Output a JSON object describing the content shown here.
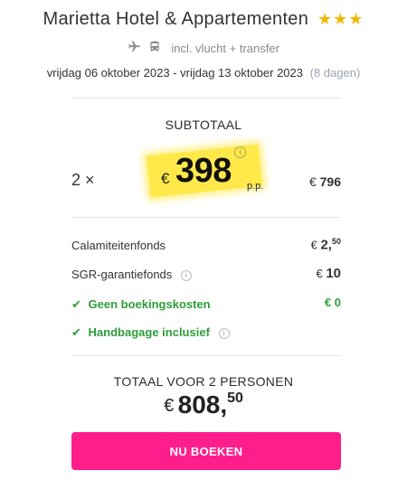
{
  "hotel": {
    "name": "Marietta Hotel & Appartementen",
    "stars": "★★★",
    "star_color": "#f5b800"
  },
  "transport": {
    "icons": [
      "airplane-icon",
      "bus-icon"
    ],
    "text": "incl. vlucht + transfer"
  },
  "dates": {
    "range": "vrijdag 06 oktober 2023 - vrijdag 13 oktober 2023",
    "duration": "(8 dagen)"
  },
  "subtotal": {
    "label": "SUBTOTAAL",
    "quantity": "2 ×",
    "currency": "€",
    "price_per_person": "398",
    "pp_label": "p.p.",
    "info": "i",
    "line_currency": "€",
    "line_total": "796"
  },
  "fees": [
    {
      "label": "Calamiteitenfonds",
      "currency": "€",
      "value_int": "2,",
      "value_dec": "50"
    },
    {
      "label": "SGR-garantiefonds",
      "info": "i",
      "currency": "€",
      "value": "10"
    }
  ],
  "included": [
    {
      "label": "Geen boekingskosten",
      "currency": "€",
      "value": "0"
    },
    {
      "label": "Handbagage inclusief",
      "info": "i"
    }
  ],
  "total": {
    "label": "TOTAAL VOOR 2 PERSONEN",
    "currency": "€",
    "amount_int": "808,",
    "amount_dec": "50"
  },
  "cta": {
    "label": "NU BOEKEN",
    "color": "#ff1e8c"
  },
  "colors": {
    "highlight": "#ffe94a",
    "green": "#2e9e3a",
    "muted": "#9aa3b2"
  }
}
